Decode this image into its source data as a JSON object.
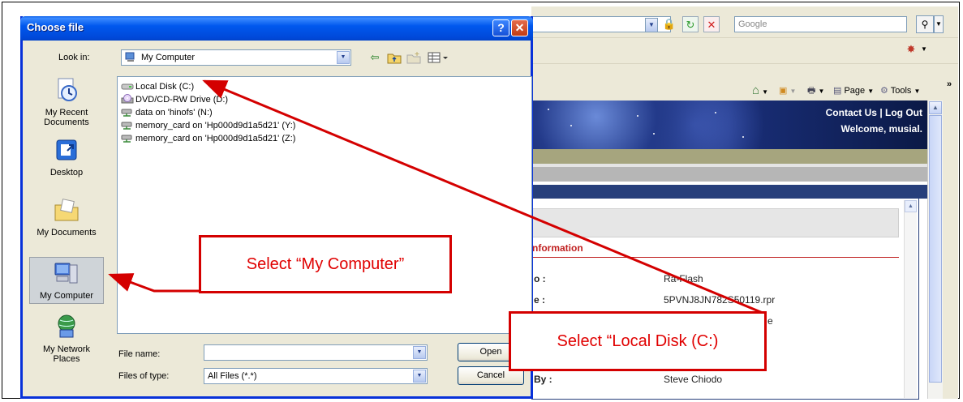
{
  "dialog": {
    "title": "Choose file",
    "help_symbol": "?",
    "close_symbol": "✕",
    "look_in_label": "Look in:",
    "look_in_value": "My Computer",
    "places": [
      {
        "label": "My Recent Documents",
        "icon": "recent-documents-icon"
      },
      {
        "label": "Desktop",
        "icon": "desktop-icon"
      },
      {
        "label": "My Documents",
        "icon": "my-documents-icon"
      },
      {
        "label": "My Computer",
        "icon": "my-computer-icon",
        "selected": true
      },
      {
        "label": "My Network Places",
        "icon": "network-places-icon"
      }
    ],
    "files": [
      {
        "name": "Local Disk (C:)",
        "icon": "hard-disk-icon"
      },
      {
        "name": "DVD/CD-RW Drive (D:)",
        "icon": "cd-drive-icon"
      },
      {
        "name": "data on 'hinofs' (N:)",
        "icon": "network-drive-icon"
      },
      {
        "name": "memory_card on 'Hp000d9d1a5d21' (Y:)",
        "icon": "network-drive-icon"
      },
      {
        "name": "memory_card on 'Hp000d9d1a5d21' (Z:)",
        "icon": "network-drive-icon"
      }
    ],
    "file_name_label": "File name:",
    "file_name_value": "",
    "files_of_type_label": "Files of type:",
    "files_of_type_value": "All Files (*.*)",
    "open_label": "Open",
    "cancel_label": "Cancel"
  },
  "browser": {
    "search_placeholder": "Google",
    "page_menu": "Page",
    "tools_menu": "Tools",
    "more_symbol": "»",
    "contact_links": "Contact Us | Log Out",
    "welcome": "Welcome, musial.",
    "info_heading": "nformation",
    "rows": [
      {
        "label": "o :",
        "value": "Ra-Flash"
      },
      {
        "label": "e :",
        "value": "5PVNJ8JN782S50119.rpr"
      },
      {
        "label": "",
        "value": "e"
      },
      {
        "label": "By :",
        "value": "Steve Chiodo"
      }
    ]
  },
  "annotations": {
    "callout_my_computer": "Select “My Computer”",
    "callout_local_disk": "Select “Local Disk (C:)",
    "color": "#d40000"
  }
}
